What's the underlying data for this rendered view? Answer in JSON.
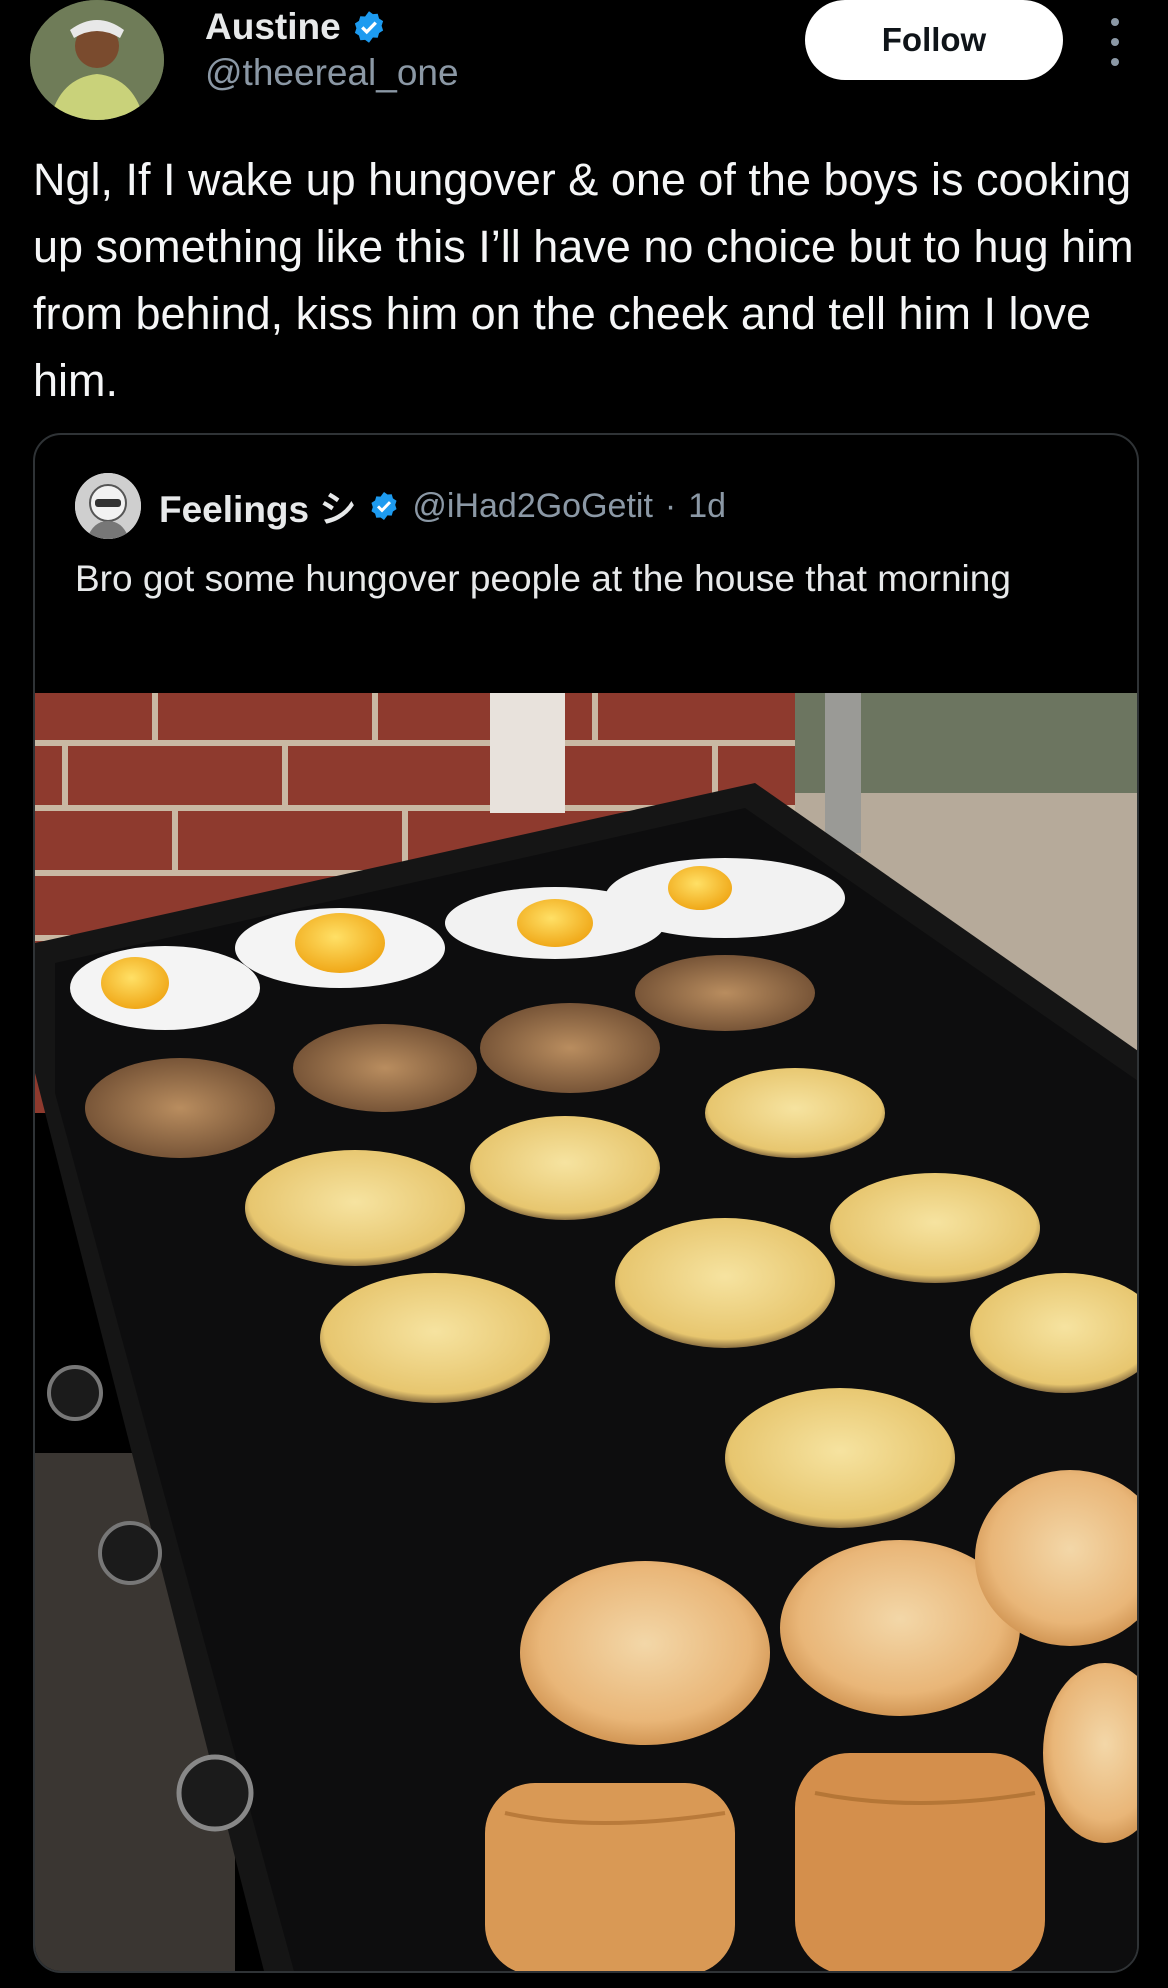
{
  "author": {
    "display_name": "Austine",
    "handle": "@theereal_one",
    "avatar_icon": "user-avatar",
    "verified_icon": "verified-badge-icon"
  },
  "actions": {
    "follow_label": "Follow",
    "more_icon": "more-options-icon"
  },
  "tweet": {
    "text": "Ngl, If I wake up hungover & one of the boys is cooking up something like this I’ll have no choice but to hug him from behind, kiss him on the cheek and tell him I love him."
  },
  "quoted_tweet": {
    "display_name": "Feelings シ",
    "handle": "@iHad2GoGetit",
    "separator": "·",
    "time": "1d",
    "text": "Bro got some hungover people at the house that morning",
    "media_icon": "griddle-breakfast-photo"
  },
  "colors": {
    "background": "#000000",
    "text": "#e7e9ea",
    "secondary": "#8b98a5",
    "verified": "#1d9bf0",
    "border": "#2f3336"
  }
}
